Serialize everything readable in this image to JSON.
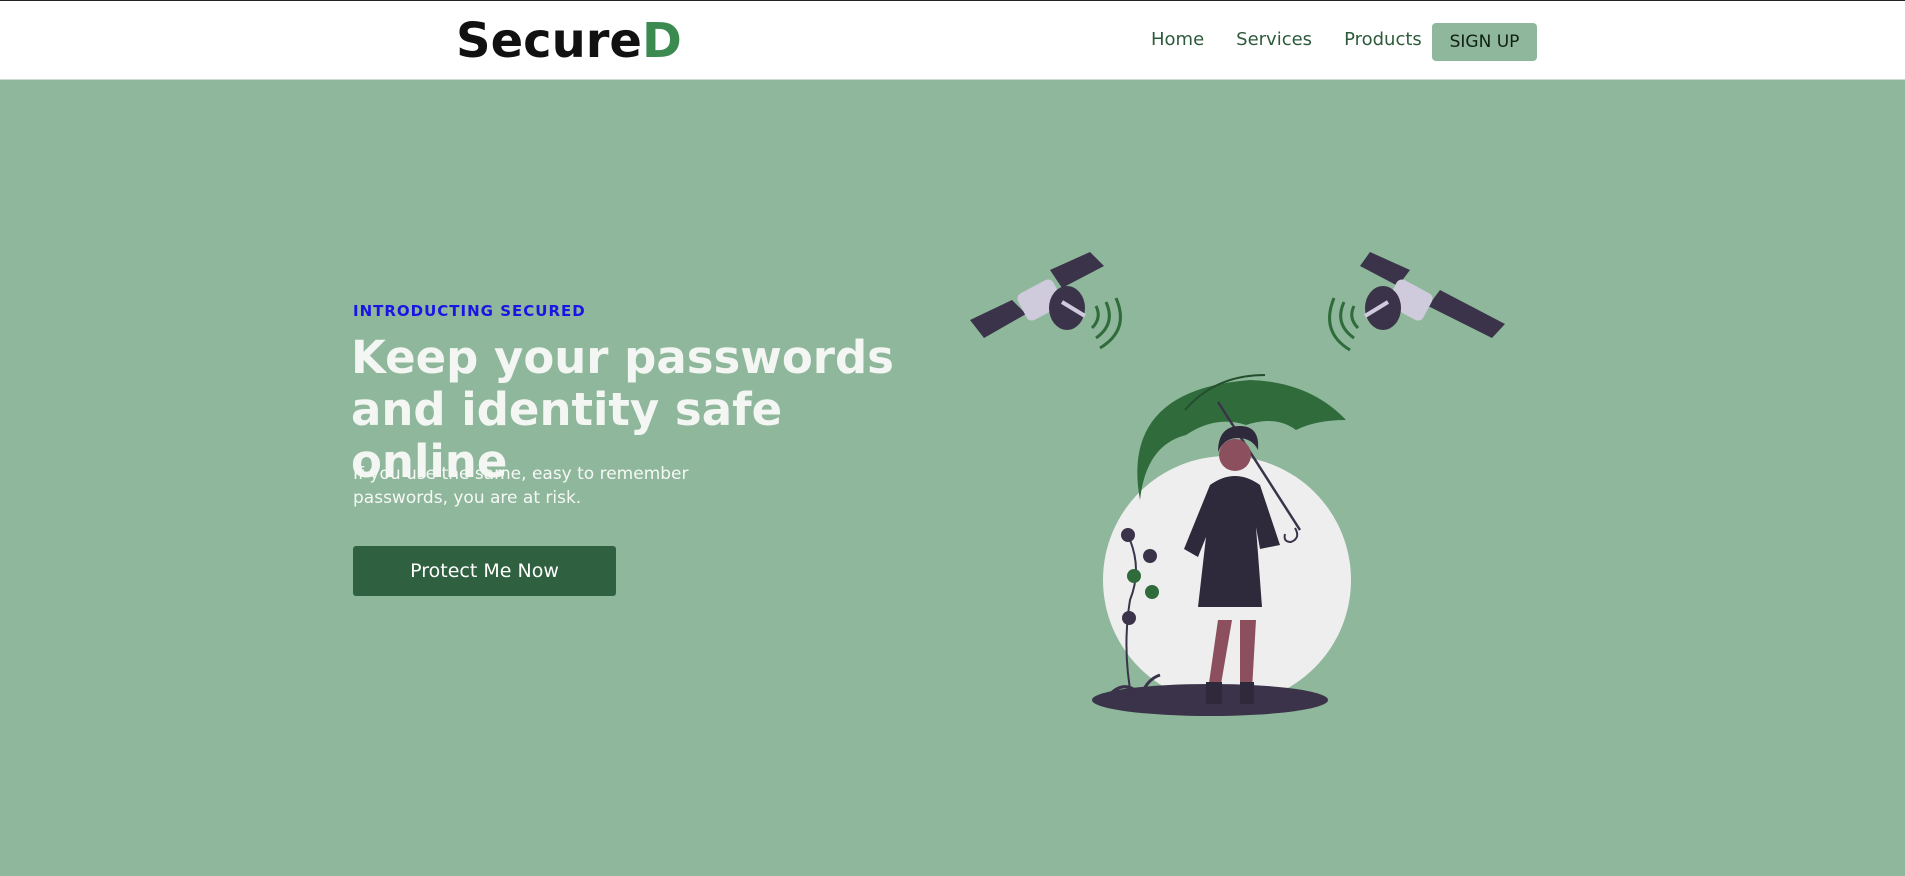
{
  "brand": {
    "name_main": "Secure",
    "name_accent": "D",
    "accent_color": "#3b8a4f"
  },
  "nav": {
    "links": [
      {
        "label": "Home"
      },
      {
        "label": "Services"
      },
      {
        "label": "Products"
      }
    ],
    "signup_label": "SIGN UP"
  },
  "hero": {
    "eyebrow": "INTRODUCTING SECURED",
    "headline": "Keep your passwords and identity safe online",
    "subtext": "If you use the same, easy to remember passwords, you are at risk.",
    "cta_label": "Protect Me Now",
    "illustration": "woman-with-umbrella-and-satellites"
  },
  "colors": {
    "background": "#8fb79b",
    "cta": "#2f6140",
    "eyebrow": "#1a14e6",
    "umbrella": "#2f6b3b"
  }
}
